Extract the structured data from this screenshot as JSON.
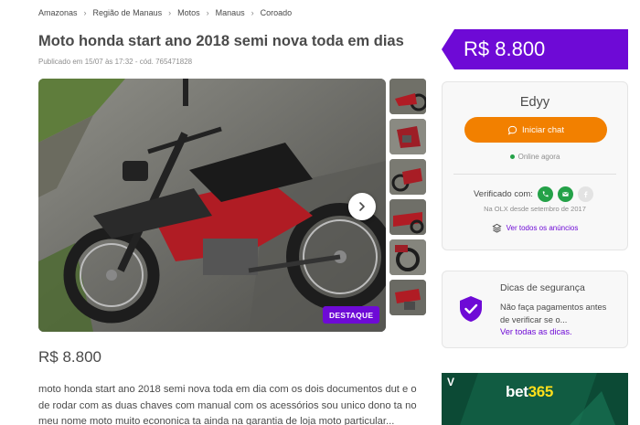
{
  "breadcrumb": [
    "Amazonas",
    "Região de Manaus",
    "Motos",
    "Manaus",
    "Coroado"
  ],
  "listing": {
    "title": "Moto honda start ano 2018 semi nova toda em dias",
    "meta": "Publicado em 15/07 às 17:32 - cód. 765471828",
    "price": "R$ 8.800",
    "badge": "DESTAQUE",
    "description": "moto honda start ano 2018 semi nova toda em dia com os dois documentos dut e o de rodar com as duas chaves com manual com os acessórios sou unico dono ta no meu nome moto muito econonica ta ainda na garantia de loja moto particular..."
  },
  "photos": {
    "next_icon": "chevron-right-icon",
    "thumbnail_count": 6
  },
  "price_tag": "R$ 8.800",
  "seller": {
    "name": "Edyy",
    "chat_label": "Iniciar chat",
    "chat_icon": "chat-bubble-icon",
    "online": "Online agora",
    "verified_label": "Verificado com:",
    "verified_icons": [
      "phone-icon",
      "email-icon",
      "facebook-icon"
    ],
    "since": "Na OLX desde setembro de 2017",
    "all_ads": "Ver todos os anúncios",
    "all_ads_icon": "layers-icon"
  },
  "tips": {
    "title": "Dicas de segurança",
    "text": "Não faça pagamentos antes de verificar se o...",
    "link": "Ver todas as dicas.",
    "icon": "shield-check-icon"
  },
  "ad": {
    "brand": "bet",
    "brand_num": "365",
    "mark": "V"
  },
  "colors": {
    "brand_purple": "#6e0ad6",
    "chat_orange": "#f28000",
    "online_green": "#24a148",
    "ad_green": "#115c42"
  }
}
